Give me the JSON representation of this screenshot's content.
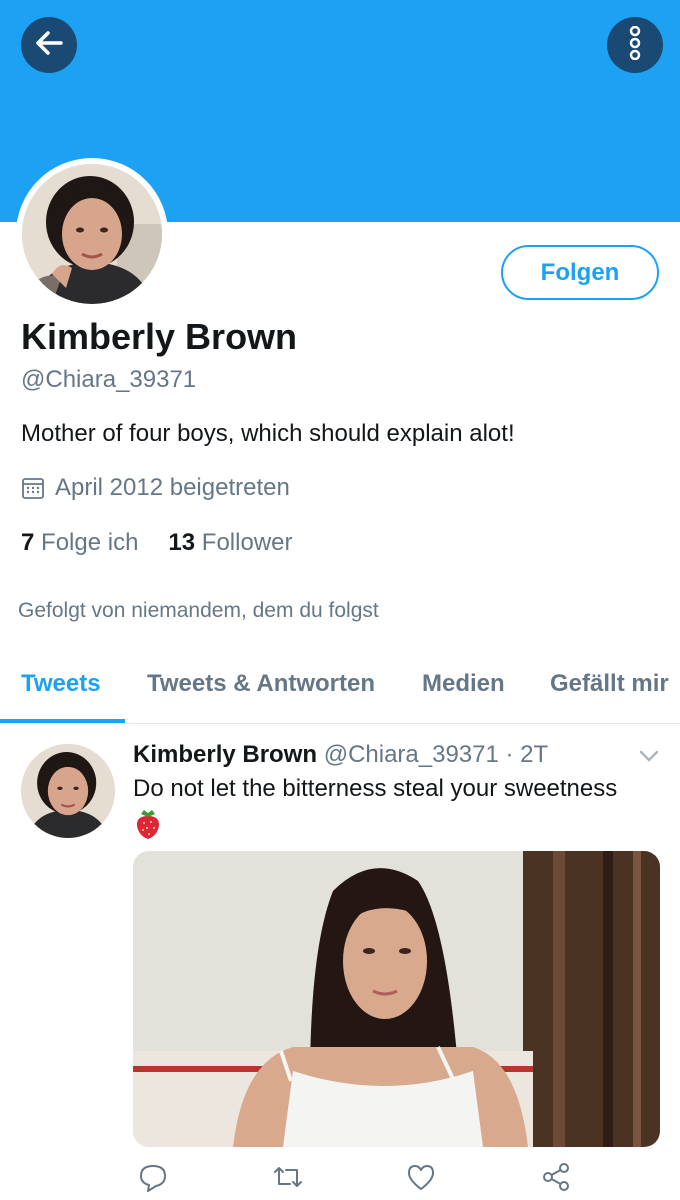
{
  "header": {
    "banner_color": "#1da1f2",
    "back_icon": "arrow-left-icon",
    "more_icon": "more-vertical-icon"
  },
  "profile": {
    "name": "Kimberly Brown",
    "handle": "@Chiara_39371",
    "bio": "Mother of four boys, which should explain alot!",
    "joined": "April 2012 beigetreten",
    "following_count": "7",
    "following_label": "Folge ich",
    "followers_count": "13",
    "followers_label": "Follower",
    "followed_by": "Gefolgt von niemandem, dem du folgst",
    "follow_button": "Folgen"
  },
  "tabs": [
    {
      "label": "Tweets",
      "active": true
    },
    {
      "label": "Tweets & Antworten",
      "active": false
    },
    {
      "label": "Medien",
      "active": false
    },
    {
      "label": "Gefällt mir",
      "active": false
    }
  ],
  "tweet": {
    "author_name": "Kimberly Brown",
    "author_handle": "@Chiara_39371 · 2T",
    "text": "Do not let the bitterness steal your sweetness",
    "emoji": "strawberry-icon",
    "actions": [
      "reply-icon",
      "retweet-icon",
      "like-icon",
      "share-icon"
    ]
  },
  "colors": {
    "accent": "#1da1f2",
    "dark_button": "#1a4a73",
    "secondary_text": "#657786"
  }
}
